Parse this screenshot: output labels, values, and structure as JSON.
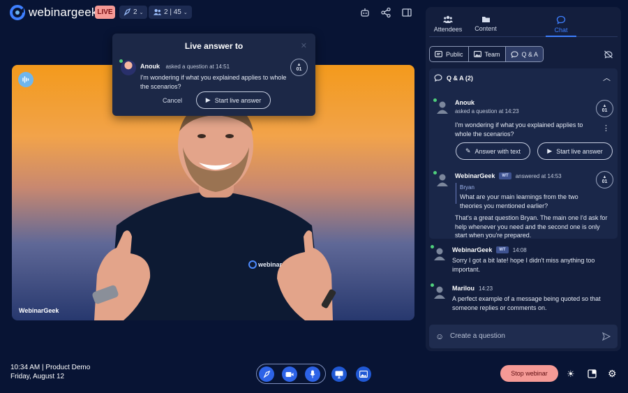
{
  "brand": {
    "name": "webinargeek",
    "live_label": "LIVE"
  },
  "topbar": {
    "presenters_count": "2",
    "attendees_count": "2 | 45"
  },
  "popup": {
    "title": "Live answer to",
    "asker": "Anouk",
    "asked_meta": "asked a question at 14:51",
    "question": "I'm wondering if what you explained applies to whole the scenarios?",
    "votes": "01",
    "cancel_label": "Cancel",
    "start_label": "Start live answer"
  },
  "video": {
    "speaker_label": "WebinarGeek",
    "shirt_logo": "webinar"
  },
  "panel": {
    "tabs": [
      {
        "label": "Attendees",
        "icon": "users-icon"
      },
      {
        "label": "Content",
        "icon": "folder-icon"
      },
      {
        "label": "Chat",
        "icon": "chat-icon",
        "active": true
      }
    ],
    "filters": [
      {
        "label": "Public"
      },
      {
        "label": "Team"
      },
      {
        "label": "Q & A",
        "active": true
      }
    ],
    "qa_header": "Q & A (2)",
    "questions": [
      {
        "name": "Anouk",
        "meta": "asked a question at 14:23",
        "text": "I'm wondering if what you explained applies to whole the scenarios?",
        "votes": "01",
        "answer_text_label": "Answer with text",
        "live_answer_label": "Start live answer"
      },
      {
        "name": "WebinarGeek",
        "badge": "WT",
        "meta": "answered at 14:53",
        "votes": "01",
        "quote_author": "Bryan",
        "quote_text": "What are your main learnings from the two theories you mentioned earlier?",
        "text": "That's a great question Bryan. The main one I'd ask for help whenever you need and the second one is only start when you're prepared."
      }
    ],
    "messages": [
      {
        "name": "WebinarGeek",
        "badge": "WT",
        "time": "14:08",
        "text": "Sorry I got a bit late! hope I didn't miss anything too important."
      },
      {
        "name": "Marilou",
        "time": "14:23",
        "text": "A perfect example of a message being quoted so that someone replies or comments on."
      }
    ],
    "input_placeholder": "Create a question"
  },
  "footer": {
    "time_line": "10:34 AM | Product Demo",
    "date_line": "Friday, August 12",
    "stop_label": "Stop webinar"
  },
  "colors": {
    "background": "#081434",
    "panel": "#131e3d",
    "accent": "#2d63e7",
    "live": "#f59a96"
  }
}
